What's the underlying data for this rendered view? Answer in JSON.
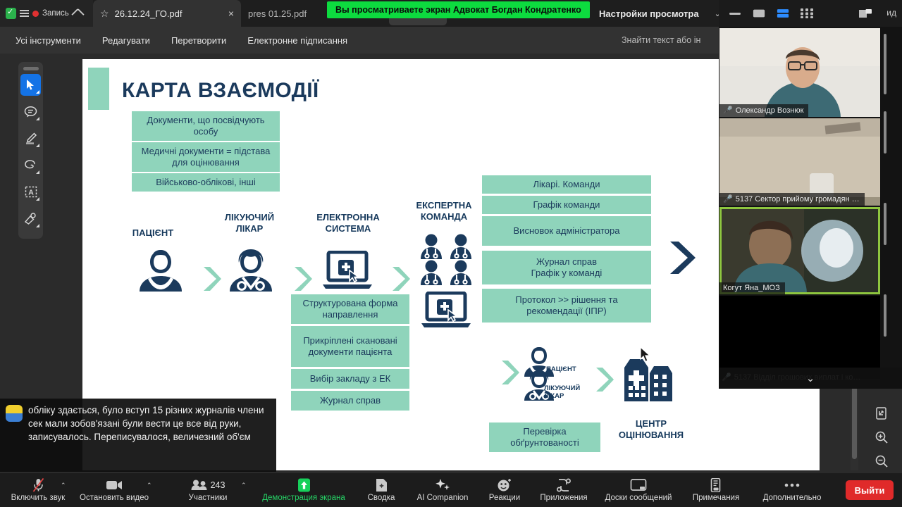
{
  "browser": {
    "recording_label": "Запись",
    "shield_icon": "shield-check-icon",
    "menu_icon": "hamburger-icon",
    "home_icon": "home-icon",
    "tabs": [
      {
        "title": "26.12.24_ГО.pdf",
        "active": true,
        "star_icon": "star-icon",
        "close_icon": "close-icon"
      },
      {
        "title": "pres 01.25.pdf",
        "active": false
      }
    ]
  },
  "share_banner": {
    "text": "Вы просматриваете экран Адвокат Богдан Кондратенко",
    "settings_label": "Настройки просмотра",
    "chevron": "⌄",
    "accent": "#0ddb3f"
  },
  "pdf": {
    "menu": [
      "Усі інструменти",
      "Редагувати",
      "Перетворити",
      "Електронне підписання"
    ],
    "search_placeholder": "Знайти текст або ін",
    "tools": [
      {
        "name": "select-tool",
        "selected": true
      },
      {
        "name": "comment-tool",
        "selected": false
      },
      {
        "name": "highlight-tool",
        "selected": false
      },
      {
        "name": "draw-tool",
        "selected": false
      },
      {
        "name": "text-select-tool",
        "selected": false
      },
      {
        "name": "stamp-tool",
        "selected": false
      }
    ],
    "right_tools": [
      {
        "name": "fit-page-icon"
      },
      {
        "name": "zoom-in-icon"
      },
      {
        "name": "zoom-out-icon"
      }
    ]
  },
  "slide": {
    "title": "КАРТА ВЗАЄМОДІЇ",
    "accent_green": "#8fd4bb",
    "accent_navy": "#1b3a5c",
    "top_boxes": [
      "Документи, що посвідчують особу",
      "Медичні документи = підстава для оцінювання",
      "Військово-облікові, інші"
    ],
    "flow_captions": {
      "patient": "ПАЦІЄНТ",
      "doctor": "ЛІКУЮЧИЙ\nЛІКАР",
      "system": "ЕЛЕКТРОННА\nСИСТЕМА",
      "expert_team": "ЕКСПЕРТНА\nКОМАНДА"
    },
    "system_boxes": [
      "Структурована форма направлення",
      "Прикріплені скановані документи пацієнта",
      "Вибір закладу з ЕК",
      "Журнал справ"
    ],
    "team_boxes": [
      "Лікарі. Команди",
      "Графік команди",
      "Висновок адміністратора",
      "Журнал справ\nГрафік у команді",
      "Протокол >> рішення та рекомендації (ІПР)"
    ],
    "bottom_flow": {
      "patient": "ПАЦІЄНТ",
      "doctor": "ЛІКУЮЧИЙ\nЛІКАР",
      "check_box": "Перевірка обґрунтованості",
      "center": "ЦЕНТР\nОЦІНЮВАННЯ"
    }
  },
  "zoom_panel": {
    "layout_buttons": [
      {
        "name": "minimize-view-icon"
      },
      {
        "name": "speaker-view-icon"
      },
      {
        "name": "split-view-icon",
        "active": true
      },
      {
        "name": "gallery-view-icon"
      }
    ],
    "pip_icon": "picture-in-picture-icon",
    "pip_label": "ид",
    "tiles": [
      {
        "name": "Олександр Вознюк",
        "muted": true,
        "speaking": false
      },
      {
        "name": "5137 Сектор прийому громадян …",
        "muted": true,
        "speaking": false
      },
      {
        "name": "Когут Яна_МОЗ",
        "muted": false,
        "speaking": true
      },
      {
        "name": "5137 Відділ грошових виплат і ко…",
        "muted": true,
        "speaking": false
      }
    ],
    "collapse_icon": "chevron-down-icon"
  },
  "captions": {
    "text": "обліку здається, було вступ 15 різних журналів члени сек мали зобов'язані були вести це все від руки, записувалось. Переписувалося, величезний об'єм"
  },
  "zoom_bar": {
    "buttons": [
      {
        "label": "Включить звук",
        "icon": "mic-muted-icon",
        "caret": true,
        "highlight": false
      },
      {
        "label": "Остановить видео",
        "icon": "camera-icon",
        "caret": true,
        "highlight": false
      },
      {
        "label": "Участники",
        "icon": "participants-icon",
        "count": "243",
        "caret": true,
        "highlight": false
      },
      {
        "label": "Демонстрация экрана",
        "icon": "share-screen-icon",
        "caret": false,
        "highlight": true
      },
      {
        "label": "Сводка",
        "icon": "summary-icon",
        "caret": false,
        "highlight": false
      },
      {
        "label": "AI Companion",
        "icon": "ai-sparkle-icon",
        "caret": false,
        "highlight": false
      },
      {
        "label": "Реакции",
        "icon": "reactions-icon",
        "caret": false,
        "highlight": false
      },
      {
        "label": "Приложения",
        "icon": "apps-icon",
        "caret": false,
        "highlight": false
      },
      {
        "label": "Доски сообщений",
        "icon": "whiteboard-icon",
        "caret": false,
        "highlight": false
      },
      {
        "label": "Примечания",
        "icon": "notes-icon",
        "caret": false,
        "highlight": false
      },
      {
        "label": "Дополнительно",
        "icon": "more-dots-icon",
        "caret": false,
        "highlight": false
      }
    ],
    "leave_label": "Выйти",
    "leave_color": "#e02a2a"
  }
}
